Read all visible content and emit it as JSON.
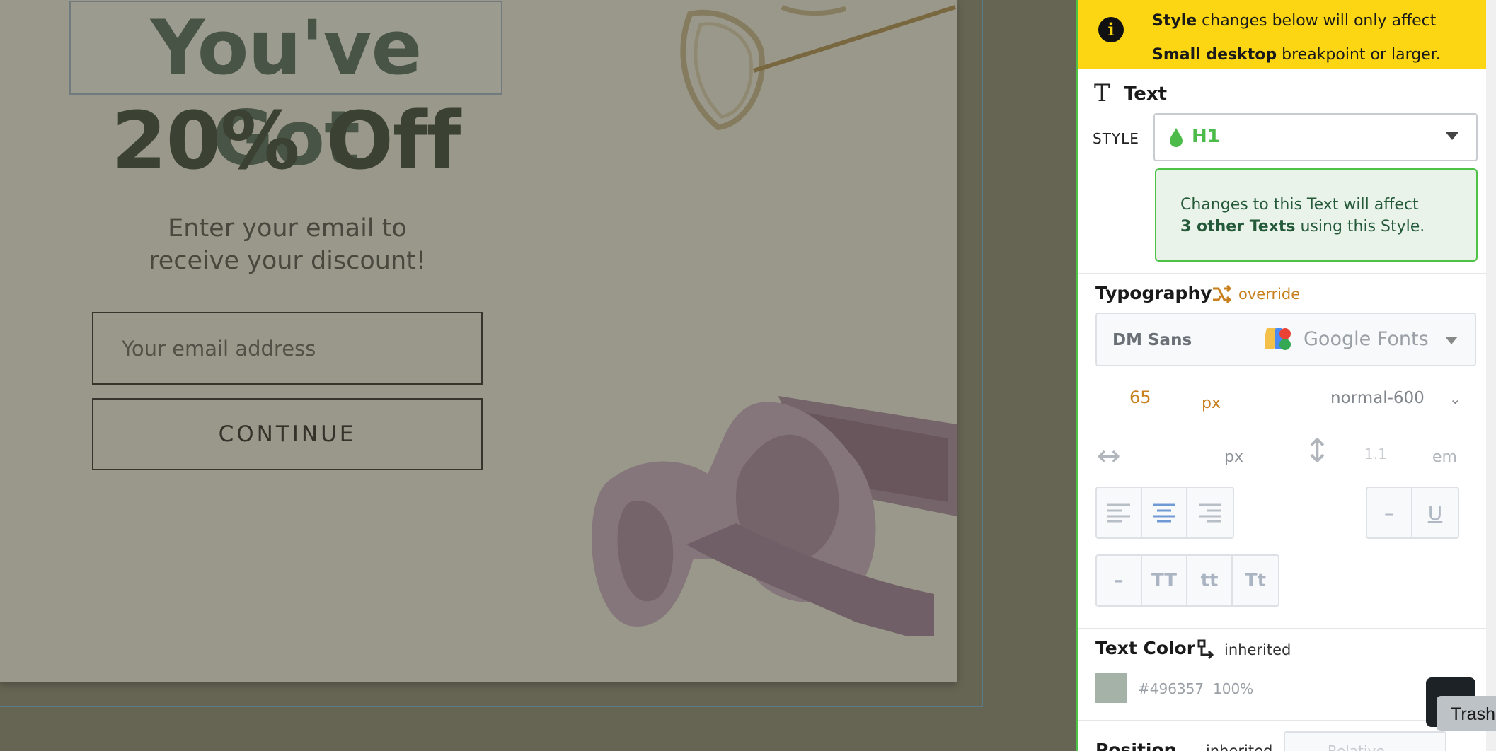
{
  "popup": {
    "headline_line1": "You've Got",
    "headline_line2": "20% Off",
    "subtext_line1": "Enter your email to",
    "subtext_line2": "receive your discount!",
    "email_placeholder": "Your email address",
    "continue_label": "CONTINUE"
  },
  "panel": {
    "notice": {
      "strong1": "Style",
      "text1": " changes below will only affect",
      "strong2": "Small desktop",
      "text2": " breakpoint or larger."
    },
    "text_section": {
      "title": "Text",
      "style_label": "STYLE",
      "style_value": "H1",
      "info_line1": "Changes to this Text will affect",
      "info_strong": "3 other Texts",
      "info_line2_rest": " using this Style."
    },
    "typography": {
      "title": "Typography",
      "override_label": "override",
      "font_name": "DM Sans",
      "font_source": "Google Fonts",
      "font_size": "65",
      "font_size_unit": "px",
      "font_weight": "normal-600",
      "letter_spacing_unit": "px",
      "line_height": "1.1",
      "line_height_unit": "em",
      "deco_none": "–",
      "deco_underline": "U",
      "case_none": "–",
      "case_upper": "TT",
      "case_lower": "tt",
      "case_title": "Tt"
    },
    "text_color": {
      "title": "Text Color",
      "inherit_label": "inherited",
      "hex": "#496357",
      "opacity": "100%",
      "swatch_color": "#a5b2a7"
    },
    "position": {
      "title": "Position",
      "inherit_label": "inherited",
      "value": "Relative"
    },
    "tooltip": "Trash"
  }
}
